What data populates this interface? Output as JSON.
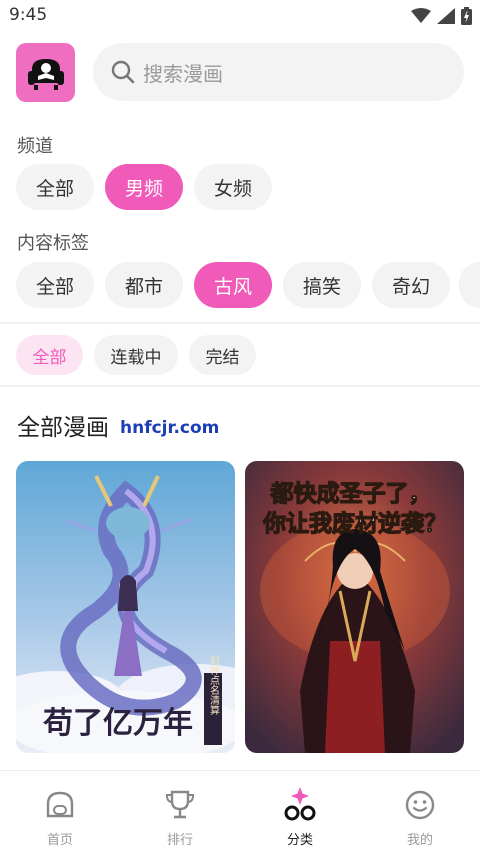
{
  "status_bar": {
    "time": "9:45"
  },
  "search": {
    "placeholder": "搜索漫画"
  },
  "channel": {
    "label": "频道",
    "chips": [
      "全部",
      "男频",
      "女频"
    ],
    "selected": "男频"
  },
  "tags": {
    "label": "内容标签",
    "chips": [
      "全部",
      "都市",
      "古风",
      "搞笑",
      "奇幻"
    ],
    "selected": "古风"
  },
  "status_filter": {
    "chips": [
      "全部",
      "连载中",
      "完结"
    ],
    "selected": "全部"
  },
  "list": {
    "title": "全部漫画",
    "watermark": "hnfcjr.com"
  },
  "comics": [
    {
      "cover_title": "苟了亿万年",
      "cover_subtitle": "封神点名清算"
    },
    {
      "cover_title": "都快成圣子了，你让我废材逆袭？"
    }
  ],
  "bottom_nav": {
    "items": [
      {
        "label": "首页",
        "icon": "home-face-icon"
      },
      {
        "label": "排行",
        "icon": "trophy-icon"
      },
      {
        "label": "分类",
        "icon": "category-icon"
      },
      {
        "label": "我的",
        "icon": "smile-icon"
      }
    ],
    "active": "分类"
  },
  "colors": {
    "accent": "#f05ab8",
    "accent_light": "#fde4f3",
    "chip_bg": "#f3f3f3"
  }
}
